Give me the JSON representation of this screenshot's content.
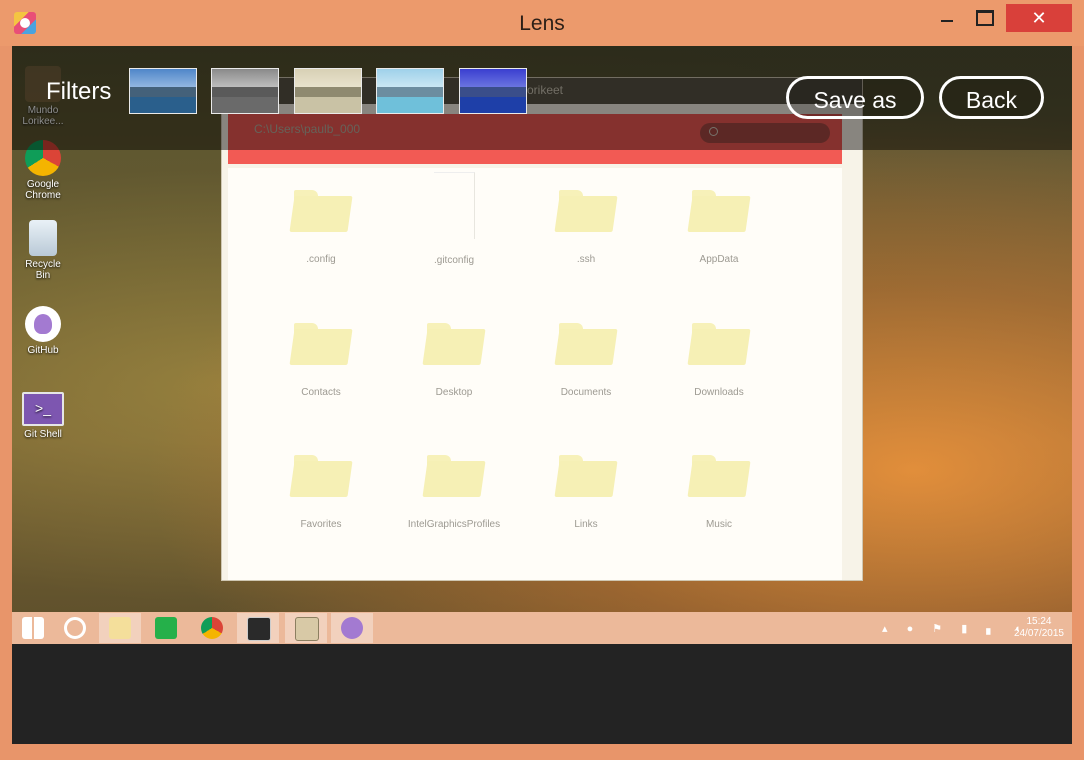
{
  "window": {
    "title": "Lens",
    "minimize_label": "",
    "maximize_label": "",
    "close_label": "✕"
  },
  "toolbar": {
    "filters_label": "Filters",
    "filters": [
      {
        "name": "original"
      },
      {
        "name": "grayscale"
      },
      {
        "name": "sepia"
      },
      {
        "name": "bright"
      },
      {
        "name": "blue"
      }
    ],
    "save_as_label": "Save as",
    "back_label": "Back"
  },
  "desktop_icons": [
    {
      "label": "Mundo Lorikee..."
    },
    {
      "label": "Google Chrome"
    },
    {
      "label": "Recycle Bin"
    },
    {
      "label": "GitHub"
    },
    {
      "label": "Git Shell"
    }
  ],
  "file_app": {
    "search_text": "orikeet",
    "path": "C:\\Users\\paulb_000",
    "items": [
      {
        "label": ".config",
        "type": "folder"
      },
      {
        "label": ".gitconfig",
        "type": "file"
      },
      {
        "label": ".ssh",
        "type": "folder"
      },
      {
        "label": "AppData",
        "type": "folder"
      },
      {
        "label": "Contacts",
        "type": "folder"
      },
      {
        "label": "Desktop",
        "type": "folder"
      },
      {
        "label": "Documents",
        "type": "folder"
      },
      {
        "label": "Downloads",
        "type": "folder"
      },
      {
        "label": "Favorites",
        "type": "folder"
      },
      {
        "label": "IntelGraphicsProfiles",
        "type": "folder"
      },
      {
        "label": "Links",
        "type": "folder"
      },
      {
        "label": "Music",
        "type": "folder"
      }
    ]
  },
  "taskbar": {
    "items": [
      "start",
      "internet-explorer",
      "file-explorer",
      "store",
      "chrome",
      "terminal",
      "explorer-window",
      "lens"
    ],
    "time": "15:24",
    "date": "24/07/2015"
  },
  "colors": {
    "frame": "#e8956a",
    "close": "#d9403a",
    "red_bar": "#f25a54"
  }
}
